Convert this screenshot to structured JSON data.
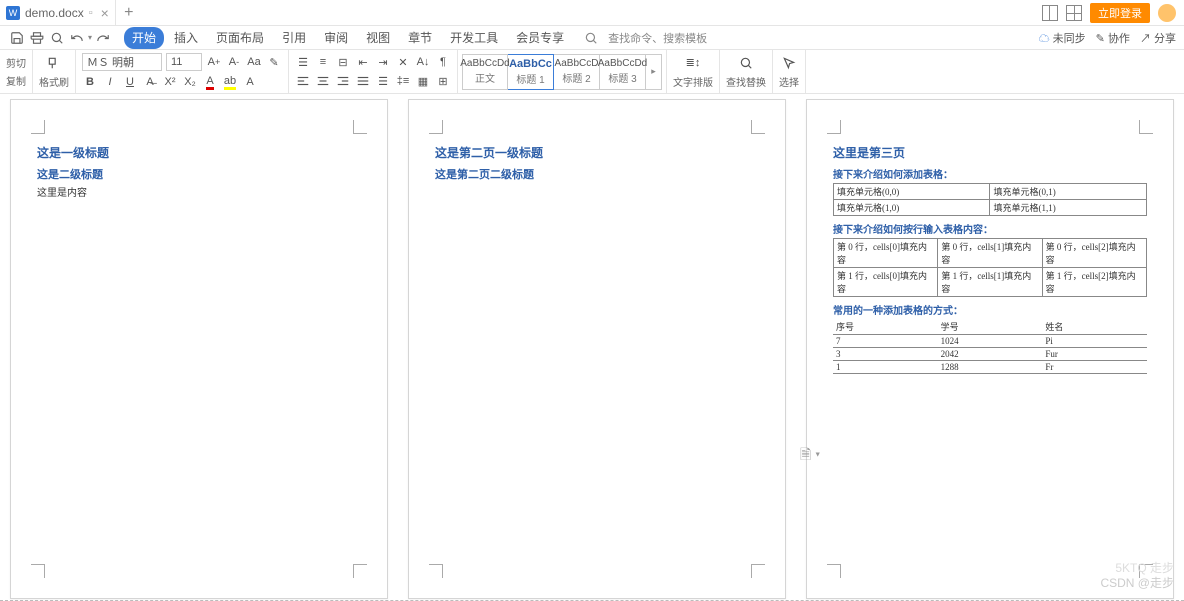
{
  "title": {
    "doc": "demo.docx"
  },
  "login_button": "立即登录",
  "menu": {
    "tabs": [
      "开始",
      "插入",
      "页面布局",
      "引用",
      "审阅",
      "视图",
      "章节",
      "开发工具",
      "会员专享"
    ],
    "search_icon_hint": "查找命令、搜索模板",
    "right": {
      "cloud": "未同步",
      "assist": "协作",
      "share": "分享"
    }
  },
  "ribbon": {
    "clip": {
      "cut": "剪切",
      "copy": "复制",
      "brush": "格式刷"
    },
    "font": {
      "name": "ＭＳ 明朝",
      "size": "11"
    },
    "styles": [
      {
        "preview": "AaBbCcDd",
        "name": "正文"
      },
      {
        "preview": "AaBbCc",
        "name": "标题 1"
      },
      {
        "preview": "AaBbCcD",
        "name": "标题 2"
      },
      {
        "preview": "AaBbCcDd",
        "name": "标题 3"
      }
    ],
    "arrange": "文字排版",
    "find": "查找替换",
    "select": "选择"
  },
  "pages": {
    "p1": {
      "h1": "这是一级标题",
      "h2": "这是二级标题",
      "body": "这里是内容"
    },
    "p2": {
      "h1": "这是第二页一级标题",
      "h2": "这是第二页二级标题"
    },
    "p3": {
      "h1": "这里是第三页",
      "sec1": "接下来介绍如何添加表格：",
      "t1": [
        [
          "填充单元格(0,0)",
          "填充单元格(0,1)"
        ],
        [
          "填充单元格(1,0)",
          "填充单元格(1,1)"
        ]
      ],
      "sec2": "接下来介绍如何按行输入表格内容：",
      "t2": [
        [
          "第 0 行，cells[0]填充内容",
          "第 0 行，cells[1]填充内容",
          "第 0 行，cells[2]填充内容"
        ],
        [
          "第 1 行，cells[0]填充内容",
          "第 1 行，cells[1]填充内容",
          "第 1 行，cells[2]填充内容"
        ]
      ],
      "sec3": "常用的一种添加表格的方式：",
      "t3": {
        "header": [
          "序号",
          "学号",
          "姓名"
        ],
        "rows": [
          [
            "7",
            "1024",
            "Pi"
          ],
          [
            "3",
            "2042",
            "Fur"
          ],
          [
            "1",
            "1288",
            "Fr"
          ]
        ]
      }
    }
  },
  "watermark": {
    "a": "5KTQ 走步",
    "b": "CSDN @走步"
  }
}
